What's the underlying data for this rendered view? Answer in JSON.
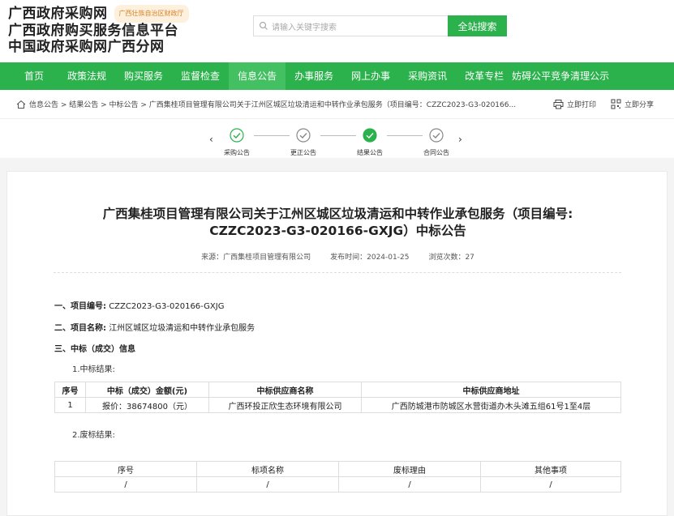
{
  "header": {
    "brand_line1": "广西政府采购网",
    "brand_tag": "广西壮族自治区财政厅",
    "brand_line2": "广西政府购买服务信息平台",
    "brand_line3": "中国政府采购网广西分网",
    "search_placeholder": "请输入关键字搜索",
    "search_button": "全站搜索",
    "accent_color": "#2bb24c"
  },
  "nav": {
    "items": [
      "首页",
      "政策法规",
      "购买服务",
      "监督检查",
      "信息公告",
      "办事服务",
      "网上办事",
      "采购资讯",
      "改革专栏",
      "妨碍公平竞争清理公示"
    ],
    "active": "信息公告"
  },
  "breadcrumb": {
    "path": "信息公告 > 结果公告 > 中标公告 > 广西集桂项目管理有限公司关于江州区城区垃圾清运和中转作业承包服务（项目编号：CZZC2023-G3-020166...",
    "print": "立即打印",
    "share": "立即分享"
  },
  "steps": [
    "采购公告",
    "更正公告",
    "结果公告",
    "合同公告"
  ],
  "article": {
    "title_line1": "广西集桂项目管理有限公司关于江州区城区垃圾清运和中转作业承包服务（项目编号:",
    "title_line2": "CZZC2023-G3-020166-GXJG）中标公告",
    "source": "来源：广西集桂项目管理有限公司",
    "publish_time": "发布时间：2024-01-25",
    "views": "浏览次数：27",
    "s1_label": "一、项目编号:",
    "s1_value": "CZZC2023-G3-020166-GXJG",
    "s2_label": "二、项目名称:",
    "s2_value": "江州区城区垃圾清运和中转作业承包服务",
    "s3_label": "三、中标（成交）信息",
    "sub1": "1.中标结果:",
    "sub2": "2.废标结果:"
  },
  "result_table": {
    "headers": [
      "序号",
      "中标（成交）金额(元)",
      "中标供应商名称",
      "中标供应商地址"
    ],
    "rows": [
      [
        "1",
        "报价：38674800（元）",
        "广西环投正欣生态环境有限公司",
        "广西防城港市防城区水营街道办木头滩五组61号1至4层"
      ]
    ]
  },
  "void_table": {
    "headers": [
      "序号",
      "标项名称",
      "废标理由",
      "其他事项"
    ],
    "rows": [
      [
        "/",
        "/",
        "/",
        "/"
      ]
    ]
  }
}
